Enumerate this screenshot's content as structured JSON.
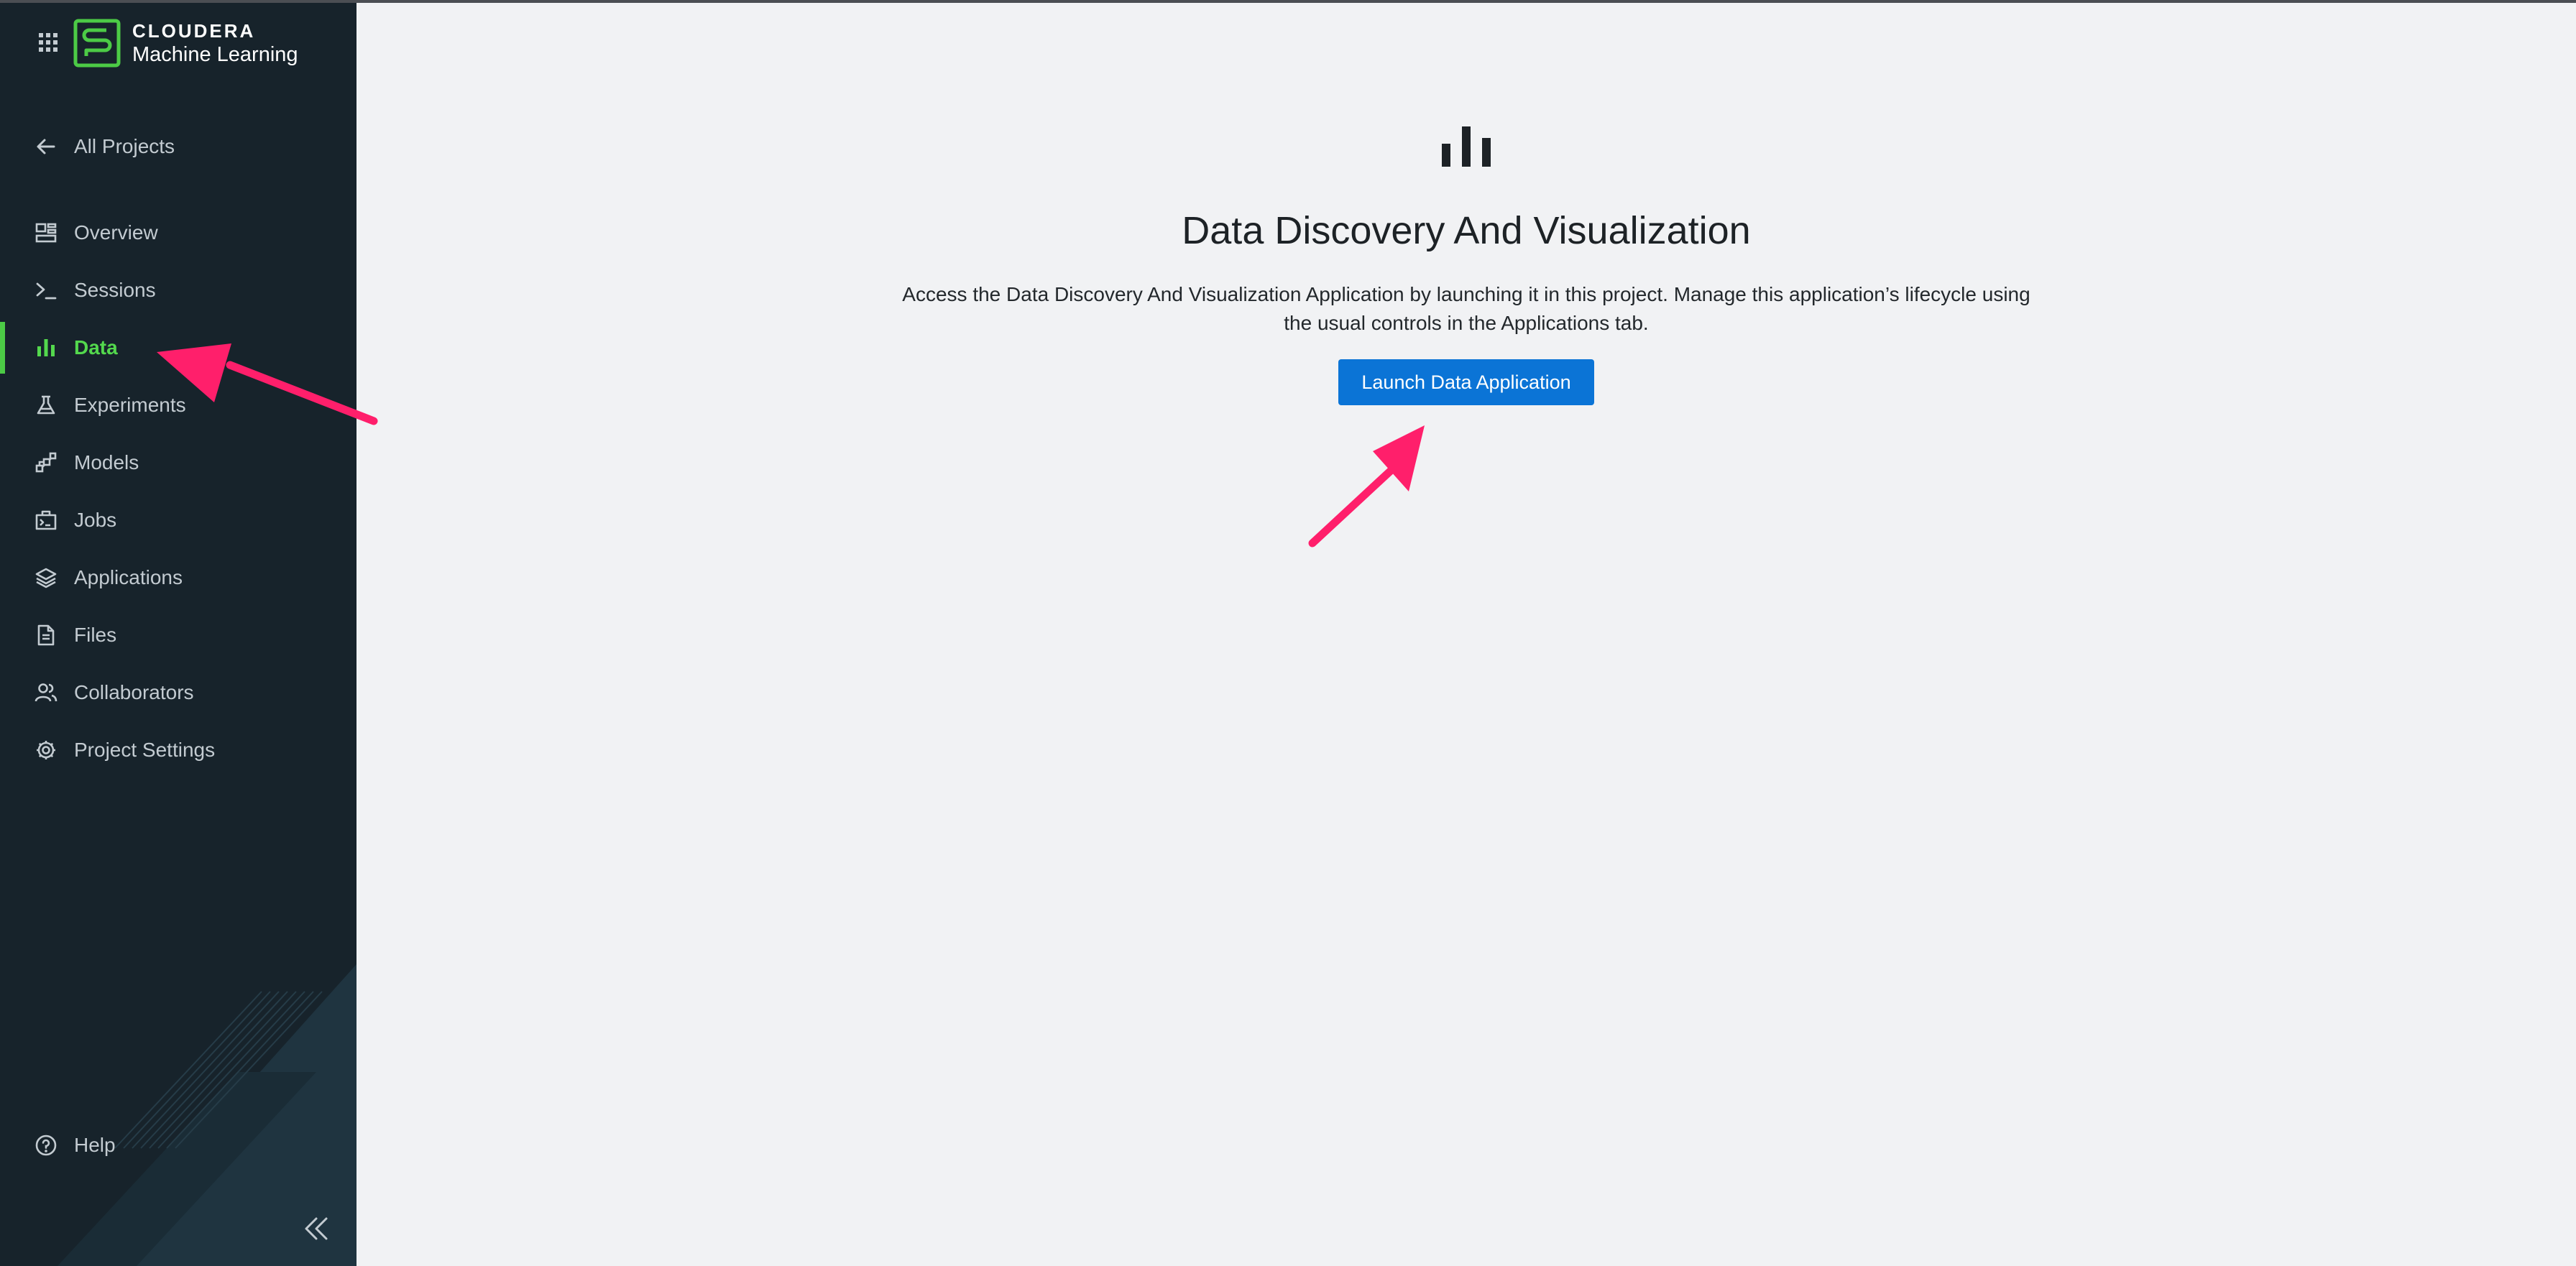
{
  "brand": {
    "company": "CLOUDERA",
    "product": "Machine Learning",
    "logo_icon": "cloudera-logo-icon",
    "apps_icon": "app-grid-icon",
    "accent_color": "#4ccb46"
  },
  "sidebar": {
    "back_link": {
      "label": "All Projects",
      "icon": "arrow-left-icon"
    },
    "items": [
      {
        "label": "Overview",
        "icon": "dashboard-icon"
      },
      {
        "label": "Sessions",
        "icon": "terminal-icon"
      },
      {
        "label": "Data",
        "icon": "bar-chart-icon",
        "active": true
      },
      {
        "label": "Experiments",
        "icon": "flask-icon"
      },
      {
        "label": "Models",
        "icon": "model-icon"
      },
      {
        "label": "Jobs",
        "icon": "jobs-icon"
      },
      {
        "label": "Applications",
        "icon": "layers-icon"
      },
      {
        "label": "Files",
        "icon": "file-icon"
      },
      {
        "label": "Collaborators",
        "icon": "users-icon"
      },
      {
        "label": "Project Settings",
        "icon": "gear-icon"
      }
    ],
    "help": {
      "label": "Help",
      "icon": "help-icon"
    },
    "collapse_icon": "double-chevron-left-icon",
    "background_color": "#17232b"
  },
  "main": {
    "icon": "bar-chart-icon",
    "title": "Data Discovery And Visualization",
    "description": "Access the Data Discovery And Visualization Application by launching it in this project. Manage this application’s lifecycle using the usual controls in the Applications tab.",
    "launch_button": "Launch Data Application",
    "button_color": "#0b74d6",
    "background_color": "#f1f2f4"
  },
  "annotations": {
    "arrow_color": "#ff1f6b"
  }
}
